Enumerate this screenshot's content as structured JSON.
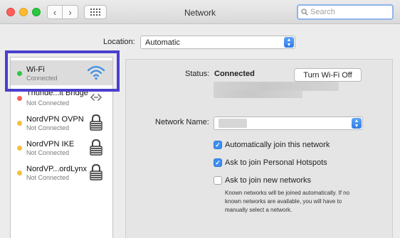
{
  "window": {
    "title": "Network"
  },
  "search": {
    "placeholder": "Search"
  },
  "location": {
    "label": "Location:",
    "value": "Automatic"
  },
  "sidebar": {
    "items": [
      {
        "name": "Wi-Fi",
        "status": "Connected",
        "dot_color": "#2ac845",
        "icon": "wifi-icon"
      },
      {
        "name": "Thunde...lt Bridge",
        "status": "Not Connected",
        "dot_color": "#fd5f57",
        "icon": "thunderbolt-bridge-icon"
      },
      {
        "name": "NordVPN OVPN",
        "status": "Not Connected",
        "dot_color": "#f5c03a",
        "icon": "vpn-lock-icon"
      },
      {
        "name": "NordVPN IKE",
        "status": "Not Connected",
        "dot_color": "#f5c03a",
        "icon": "vpn-lock-icon"
      },
      {
        "name": "NordVP...ordLynx",
        "status": "Not Connected",
        "dot_color": "#f5c03a",
        "icon": "vpn-lock-icon"
      }
    ]
  },
  "detail": {
    "status_label": "Status:",
    "status_value": "Connected",
    "turn_off_label": "Turn Wi-Fi Off",
    "network_name_label": "Network Name:",
    "options": [
      {
        "label": "Automatically join this network",
        "checked": true
      },
      {
        "label": "Ask to join Personal Hotspots",
        "checked": true
      },
      {
        "label": "Ask to join new networks",
        "checked": false
      }
    ],
    "hint": "Known networks will be joined automatically. If no known networks are available, you will have to manually select a network."
  },
  "colors": {
    "accent": "#3c8ef3",
    "highlight": "#4b3fcc"
  }
}
